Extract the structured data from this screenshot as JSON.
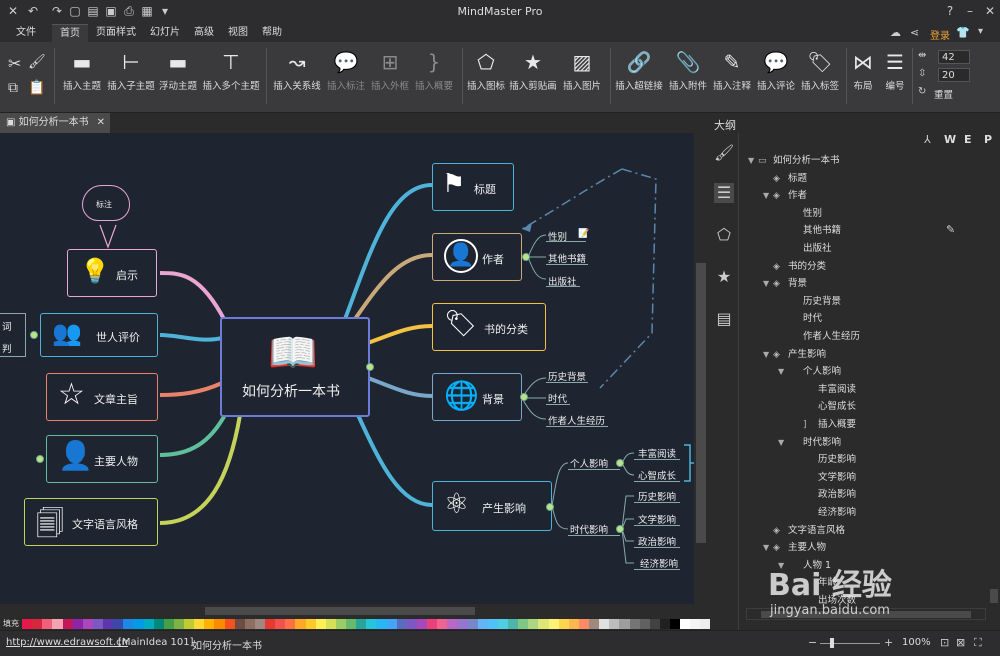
{
  "app": {
    "title": "MindMaster Pro",
    "login": "登录"
  },
  "menu": [
    "文件",
    "首页",
    "页面样式",
    "幻灯片",
    "高级",
    "视图",
    "帮助"
  ],
  "ribbon": {
    "buttons": [
      "插入主题",
      "插入子主题",
      "浮动主题",
      "插入多个主题",
      "插入关系线",
      "插入标注",
      "插入外框",
      "插入概要",
      "插入图标",
      "插入剪贴画",
      "插入图片",
      "插入超链接",
      "插入附件",
      "插入注释",
      "插入评论",
      "插入标签",
      "布局",
      "编号"
    ],
    "spin1": "42",
    "spin2": "20",
    "reset": "重置"
  },
  "doc_tab": "如何分析一本书",
  "canvas": {
    "center": "如何分析一本书",
    "callout": "标注",
    "left_nodes": [
      "启示",
      "世人评价",
      "文章主旨",
      "主要人物",
      "文字语言风格"
    ],
    "left_cut": [
      "词",
      "判"
    ],
    "right_nodes": [
      "标题",
      "作者",
      "书的分类",
      "背景",
      "产生影响"
    ],
    "author_subs": [
      "性别",
      "其他书籍",
      "出版社"
    ],
    "background_subs": [
      "历史背景",
      "时代",
      "作者人生经历"
    ],
    "impact_personal": "个人影响",
    "impact_personal_subs": [
      "丰富阅读",
      "心智成长"
    ],
    "impact_era": "时代影响",
    "impact_era_subs": [
      "历史影响",
      "文学影响",
      "政治影响",
      "经济影响"
    ]
  },
  "palette_label": "填充",
  "palette": [
    "#e6194b",
    "#d7263d",
    "#f25f7a",
    "#f7a1b5",
    "#c2185b",
    "#8e24aa",
    "#ab47bc",
    "#7e57c2",
    "#5e35b1",
    "#3949ab",
    "#1e88e5",
    "#039be5",
    "#00acc1",
    "#00897b",
    "#43a047",
    "#7cb342",
    "#c0ca33",
    "#fdd835",
    "#ffb300",
    "#fb8c00",
    "#f4511e",
    "#6d4c41",
    "#8d6e63",
    "#a1887f",
    "#e53935",
    "#ef5350",
    "#ff7043",
    "#ffa726",
    "#ffca28",
    "#ffee58",
    "#d4e157",
    "#9ccc65",
    "#66bb6a",
    "#26a69a",
    "#26c6da",
    "#29b6f6",
    "#42a5f5",
    "#5c6bc0",
    "#7e57c2",
    "#ab47bc",
    "#ec407a",
    "#f06292",
    "#ba68c8",
    "#9575cd",
    "#7986cb",
    "#64b5f6",
    "#4fc3f7",
    "#4dd0e1",
    "#4db6ac",
    "#81c784",
    "#aed581",
    "#dce775",
    "#fff176",
    "#ffd54f",
    "#ffb74d",
    "#ff8a65",
    "#a1887f",
    "#e0e0e0",
    "#bdbdbd",
    "#9e9e9e",
    "#757575",
    "#616161",
    "#424242",
    "#212121",
    "#000000",
    "#ffffff",
    "#f5f5f5",
    "#eeeeee"
  ],
  "outline": {
    "title": "大纲",
    "format_letters": [
      "W",
      "E",
      "P"
    ],
    "items": [
      {
        "text": "如何分析一本书",
        "level": 0,
        "toggle": "▼",
        "icon": "▭"
      },
      {
        "text": "标题",
        "level": 1,
        "toggle": "",
        "icon": "◈"
      },
      {
        "text": "作者",
        "level": 1,
        "toggle": "▼",
        "icon": "◈"
      },
      {
        "text": "性别",
        "level": 2,
        "toggle": "",
        "icon": ""
      },
      {
        "text": "其他书籍",
        "level": 2,
        "toggle": "",
        "icon": ""
      },
      {
        "text": "出版社",
        "level": 2,
        "toggle": "",
        "icon": ""
      },
      {
        "text": "书的分类",
        "level": 1,
        "toggle": "",
        "icon": "◈"
      },
      {
        "text": "背景",
        "level": 1,
        "toggle": "▼",
        "icon": "◈"
      },
      {
        "text": "历史背景",
        "level": 2,
        "toggle": "",
        "icon": ""
      },
      {
        "text": "时代",
        "level": 2,
        "toggle": "",
        "icon": ""
      },
      {
        "text": "作者人生经历",
        "level": 2,
        "toggle": "",
        "icon": ""
      },
      {
        "text": "产生影响",
        "level": 1,
        "toggle": "▼",
        "icon": "◈"
      },
      {
        "text": "个人影响",
        "level": 2,
        "toggle": "▼",
        "icon": ""
      },
      {
        "text": "丰富阅读",
        "level": 3,
        "toggle": "",
        "icon": ""
      },
      {
        "text": "心智成长",
        "level": 3,
        "toggle": "",
        "icon": ""
      },
      {
        "text": "插入概要",
        "level": 3,
        "toggle": "",
        "icon": "]"
      },
      {
        "text": "时代影响",
        "level": 2,
        "toggle": "▼",
        "icon": ""
      },
      {
        "text": "历史影响",
        "level": 3,
        "toggle": "",
        "icon": ""
      },
      {
        "text": "文学影响",
        "level": 3,
        "toggle": "",
        "icon": ""
      },
      {
        "text": "政治影响",
        "level": 3,
        "toggle": "",
        "icon": ""
      },
      {
        "text": "经济影响",
        "level": 3,
        "toggle": "",
        "icon": ""
      },
      {
        "text": "文字语言风格",
        "level": 1,
        "toggle": "",
        "icon": "◈"
      },
      {
        "text": "主要人物",
        "level": 1,
        "toggle": "▼",
        "icon": "◈"
      },
      {
        "text": "人物 1",
        "level": 2,
        "toggle": "▼",
        "icon": ""
      },
      {
        "text": "年龄",
        "level": 3,
        "toggle": "",
        "icon": ""
      },
      {
        "text": "出场次数",
        "level": 3,
        "toggle": "",
        "icon": ""
      }
    ]
  },
  "status": {
    "url": "http://www.edrawsoft.cn",
    "info": "[MainIdea 101]",
    "doc": "如何分析一本书",
    "zoom": "100%"
  },
  "watermark": {
    "logo": "Bai 经验",
    "url": "jingyan.baidu.com"
  }
}
